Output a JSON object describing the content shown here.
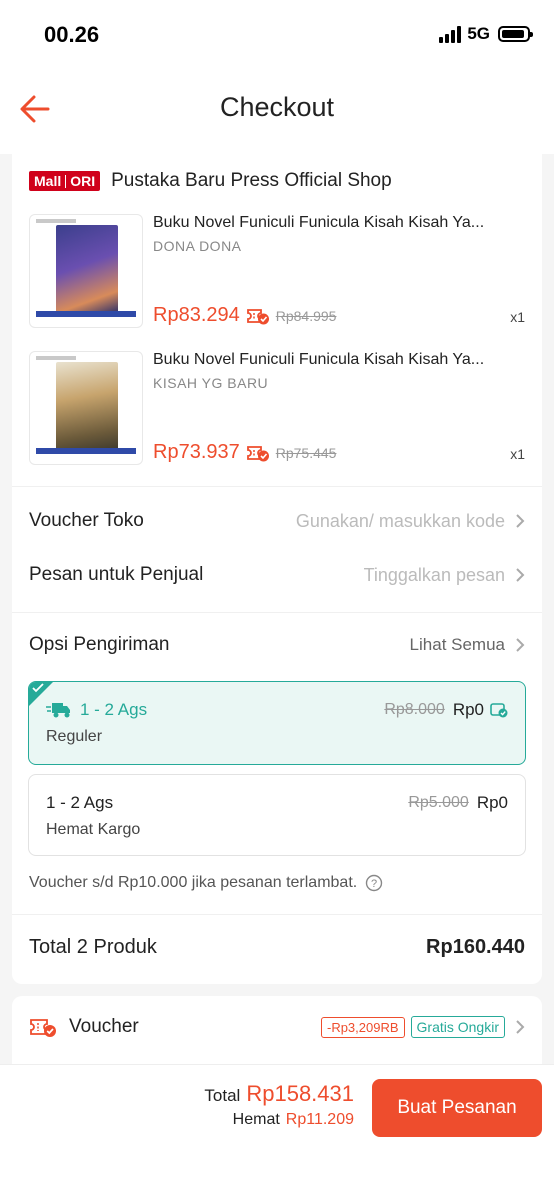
{
  "status_bar": {
    "time": "00.26",
    "network": "5G"
  },
  "header": {
    "title": "Checkout"
  },
  "shop": {
    "badge_left": "Mall",
    "badge_right": "ORI",
    "name": "Pustaka Baru Press Official Shop"
  },
  "products": [
    {
      "name": "Buku Novel Funiculi Funicula Kisah Kisah Ya...",
      "variant": "DONA DONA",
      "price": "Rp83.294",
      "old_price": "Rp84.995",
      "qty": "x1"
    },
    {
      "name": "Buku Novel Funiculi Funicula Kisah Kisah Ya...",
      "variant": "KISAH YG BARU",
      "price": "Rp73.937",
      "old_price": "Rp75.445",
      "qty": "x1"
    }
  ],
  "voucher_toko": {
    "label": "Voucher Toko",
    "value": "Gunakan/ masukkan kode"
  },
  "pesan": {
    "label": "Pesan untuk Penjual",
    "value": "Tinggalkan pesan"
  },
  "shipping": {
    "label": "Opsi Pengiriman",
    "see_all": "Lihat Semua",
    "options": [
      {
        "eta": "1 - 2 Ags",
        "type": "Reguler",
        "old_price": "Rp8.000",
        "price": "Rp0"
      },
      {
        "eta": "1 - 2 Ags",
        "type": "Hemat Kargo",
        "old_price": "Rp5.000",
        "price": "Rp0"
      }
    ],
    "note": "Voucher s/d Rp10.000 jika pesanan terlambat."
  },
  "total": {
    "label": "Total 2 Produk",
    "value": "Rp160.440"
  },
  "voucher": {
    "label": "Voucher",
    "discount_tag": "-Rp3,209RB",
    "free_tag": "Gratis Ongkir"
  },
  "footer": {
    "total_label": "Total",
    "total_value": "Rp158.431",
    "save_label": "Hemat",
    "save_value": "Rp11.209",
    "button": "Buat Pesanan"
  },
  "colors": {
    "accent": "#ee4d2d",
    "teal": "#26aa99",
    "mall": "#d0011b"
  }
}
